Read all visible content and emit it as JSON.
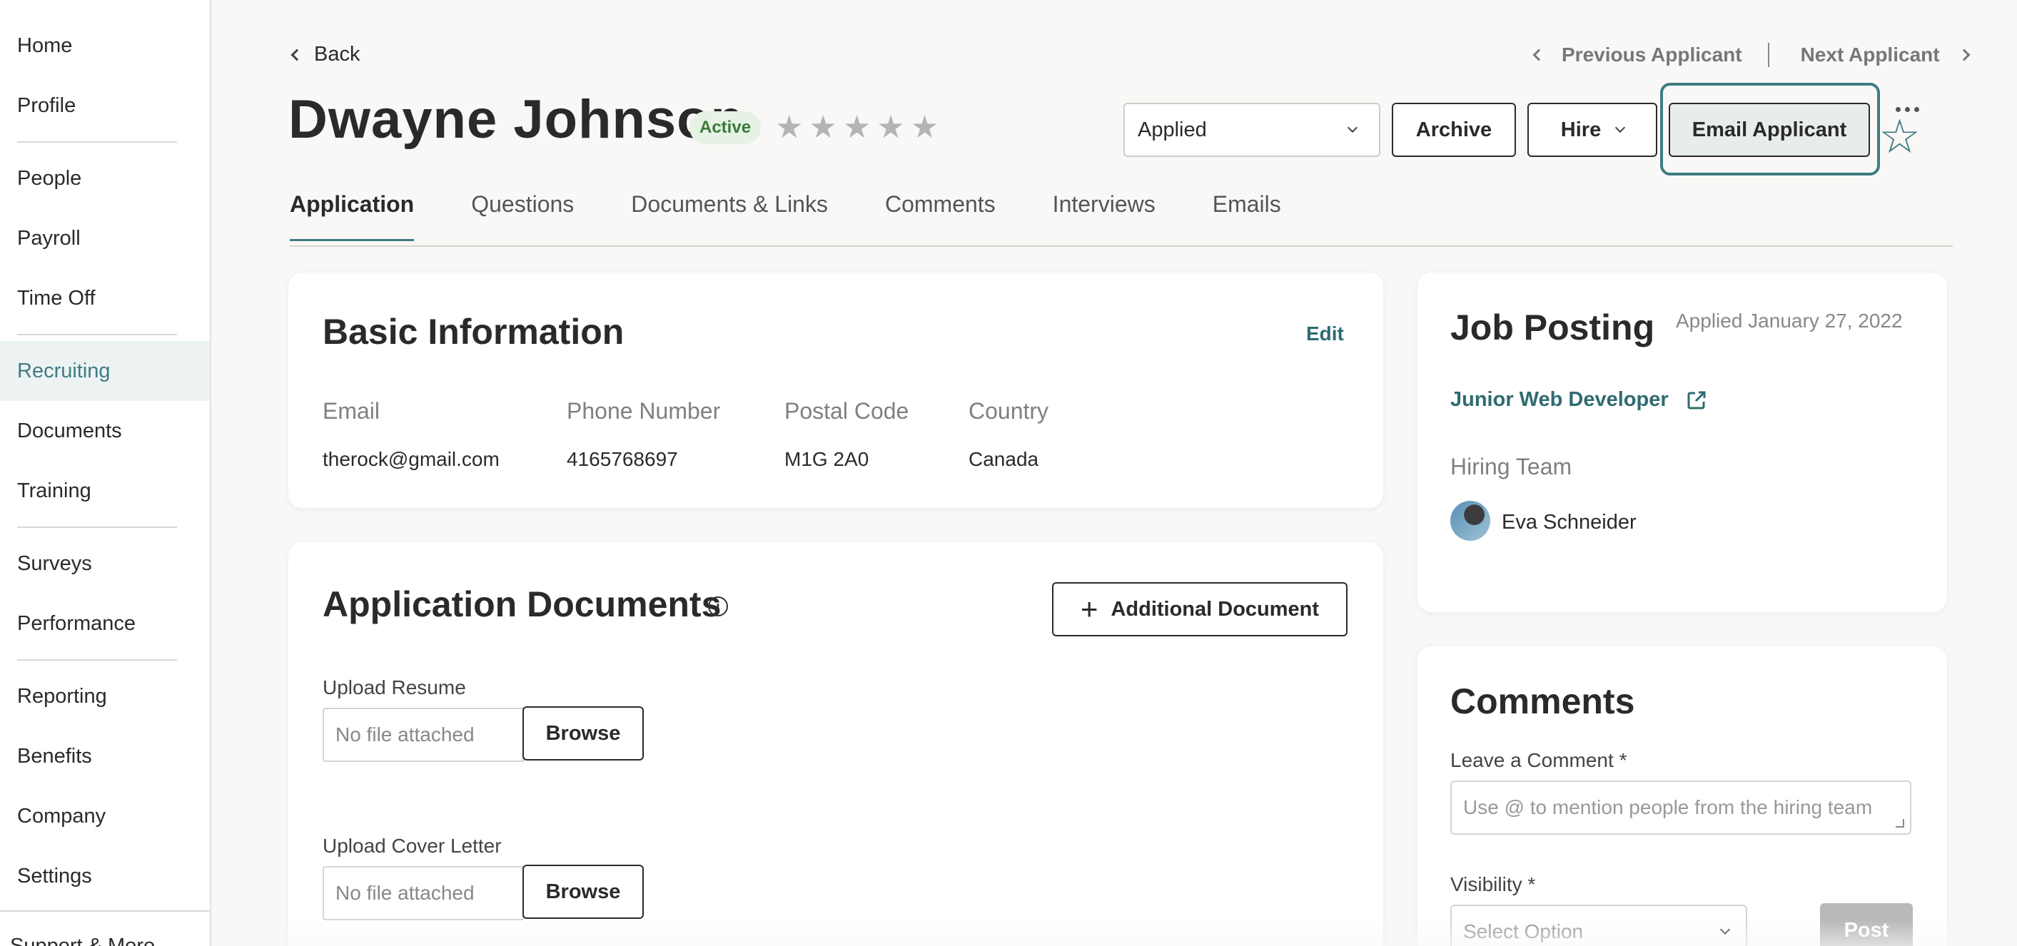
{
  "sidebar": {
    "items": [
      {
        "label": "Home"
      },
      {
        "label": "Profile"
      },
      {
        "label": "People"
      },
      {
        "label": "Payroll"
      },
      {
        "label": "Time Off"
      },
      {
        "label": "Recruiting"
      },
      {
        "label": "Documents"
      },
      {
        "label": "Training"
      },
      {
        "label": "Surveys"
      },
      {
        "label": "Performance"
      },
      {
        "label": "Reporting"
      },
      {
        "label": "Benefits"
      },
      {
        "label": "Company"
      },
      {
        "label": "Settings"
      }
    ],
    "support_label": "Support & More"
  },
  "header": {
    "back_label": "Back",
    "previous_label": "Previous Applicant",
    "next_label": "Next Applicant",
    "applicant_name": "Dwayne Johnson",
    "status_badge": "Active",
    "rating": 0,
    "rating_max": 5,
    "stage_select": "Applied",
    "archive_label": "Archive",
    "hire_label": "Hire",
    "email_label": "Email Applicant"
  },
  "tabs": [
    {
      "label": "Application"
    },
    {
      "label": "Questions"
    },
    {
      "label": "Documents & Links"
    },
    {
      "label": "Comments"
    },
    {
      "label": "Interviews"
    },
    {
      "label": "Emails"
    }
  ],
  "basic_info": {
    "title": "Basic Information",
    "edit_label": "Edit",
    "fields": [
      {
        "label": "Email",
        "value": "therock@gmail.com"
      },
      {
        "label": "Phone Number",
        "value": "4165768697"
      },
      {
        "label": "Postal Code",
        "value": "M1G 2A0"
      },
      {
        "label": "Country",
        "value": "Canada"
      }
    ]
  },
  "documents": {
    "title": "Application Documents",
    "add_label": "Additional Document",
    "uploads": [
      {
        "label": "Upload Resume",
        "placeholder": "No file attached",
        "button": "Browse"
      },
      {
        "label": "Upload Cover Letter",
        "placeholder": "No file attached",
        "button": "Browse"
      }
    ]
  },
  "job_posting": {
    "title": "Job Posting",
    "applied_date": "Applied January 27, 2022",
    "job_title": "Junior Web Developer",
    "hiring_team_label": "Hiring Team",
    "member_name": "Eva Schneider"
  },
  "comments": {
    "title": "Comments",
    "comment_label": "Leave a Comment *",
    "comment_placeholder": "Use @ to mention people from the hiring team",
    "visibility_label": "Visibility *",
    "visibility_placeholder": "Select Option",
    "post_label": "Post"
  },
  "colors": {
    "accent": "#3e7c82",
    "link": "#2f6b71",
    "active_badge_bg": "#e6f2e4",
    "active_badge_text": "#3c7a3a"
  }
}
